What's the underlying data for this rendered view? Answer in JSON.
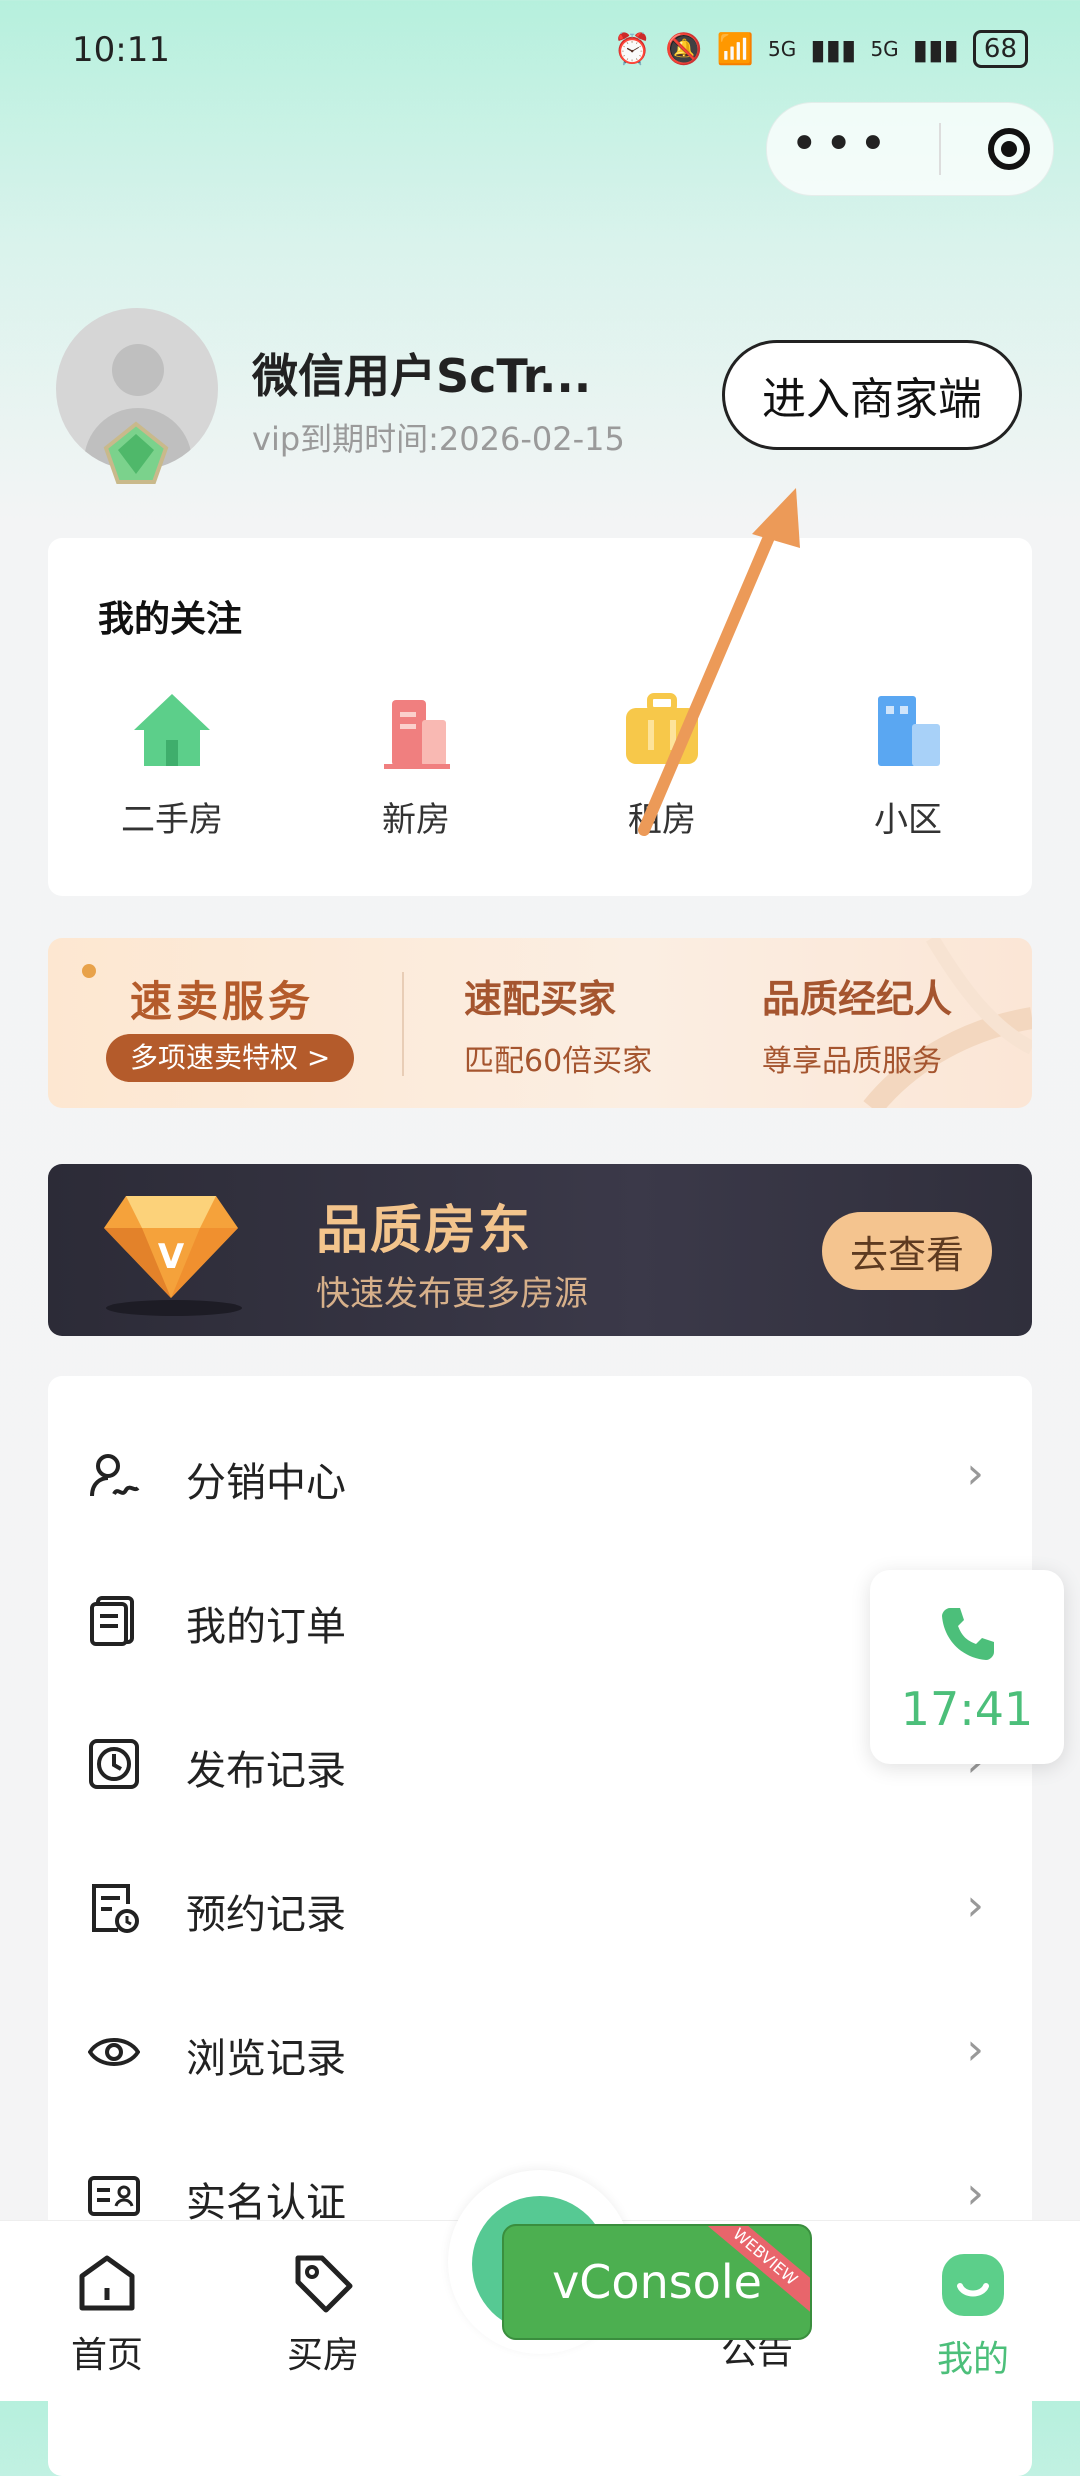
{
  "status": {
    "time": "10:11",
    "battery": "68",
    "net1": "5G",
    "net2": "5G"
  },
  "profile": {
    "name": "微信用户ScTr...",
    "vip": "vip到期时间:2026-02-15",
    "merchant_button": "进入商家端"
  },
  "follow": {
    "title": "我的关注",
    "items": [
      {
        "label": "二手房",
        "icon": "house-icon",
        "color": "#5ccf8a"
      },
      {
        "label": "新房",
        "icon": "building-icon",
        "color": "#f07f7f"
      },
      {
        "label": "租房",
        "icon": "suitcase-icon",
        "color": "#f7c84a"
      },
      {
        "label": "小区",
        "icon": "tower-icon",
        "color": "#5aa7f2"
      }
    ]
  },
  "promo": {
    "title": "速卖服务",
    "pill": "多项速卖特权 >",
    "col1_title": "速配买家",
    "col1_sub": "匹配60倍买家",
    "col2_title": "品质经纪人",
    "col2_sub": "尊享品质服务"
  },
  "landlord": {
    "title": "品质房东",
    "subtitle": "快速发布更多房源",
    "button": "去查看",
    "badge_letter": "V"
  },
  "menu": [
    {
      "label": "分销中心",
      "icon": "distribution-icon"
    },
    {
      "label": "我的订单",
      "icon": "order-icon"
    },
    {
      "label": "发布记录",
      "icon": "clock-icon"
    },
    {
      "label": "预约记录",
      "icon": "appointment-icon"
    },
    {
      "label": "浏览记录",
      "icon": "eye-icon"
    },
    {
      "label": "实名认证",
      "icon": "id-card-icon"
    }
  ],
  "call": {
    "time": "17:41"
  },
  "tabs": [
    {
      "label": "首页",
      "icon": "home-icon"
    },
    {
      "label": "买房",
      "icon": "tag-icon"
    },
    {
      "label": "公告",
      "icon": "announcement-icon"
    },
    {
      "label": "我的",
      "icon": "profile-icon"
    }
  ],
  "vconsole": {
    "label": "vConsole",
    "ribbon": "WEBVIEW"
  },
  "colors": {
    "accent": "#4cbf7a",
    "brand_orange": "#b45b2b"
  }
}
